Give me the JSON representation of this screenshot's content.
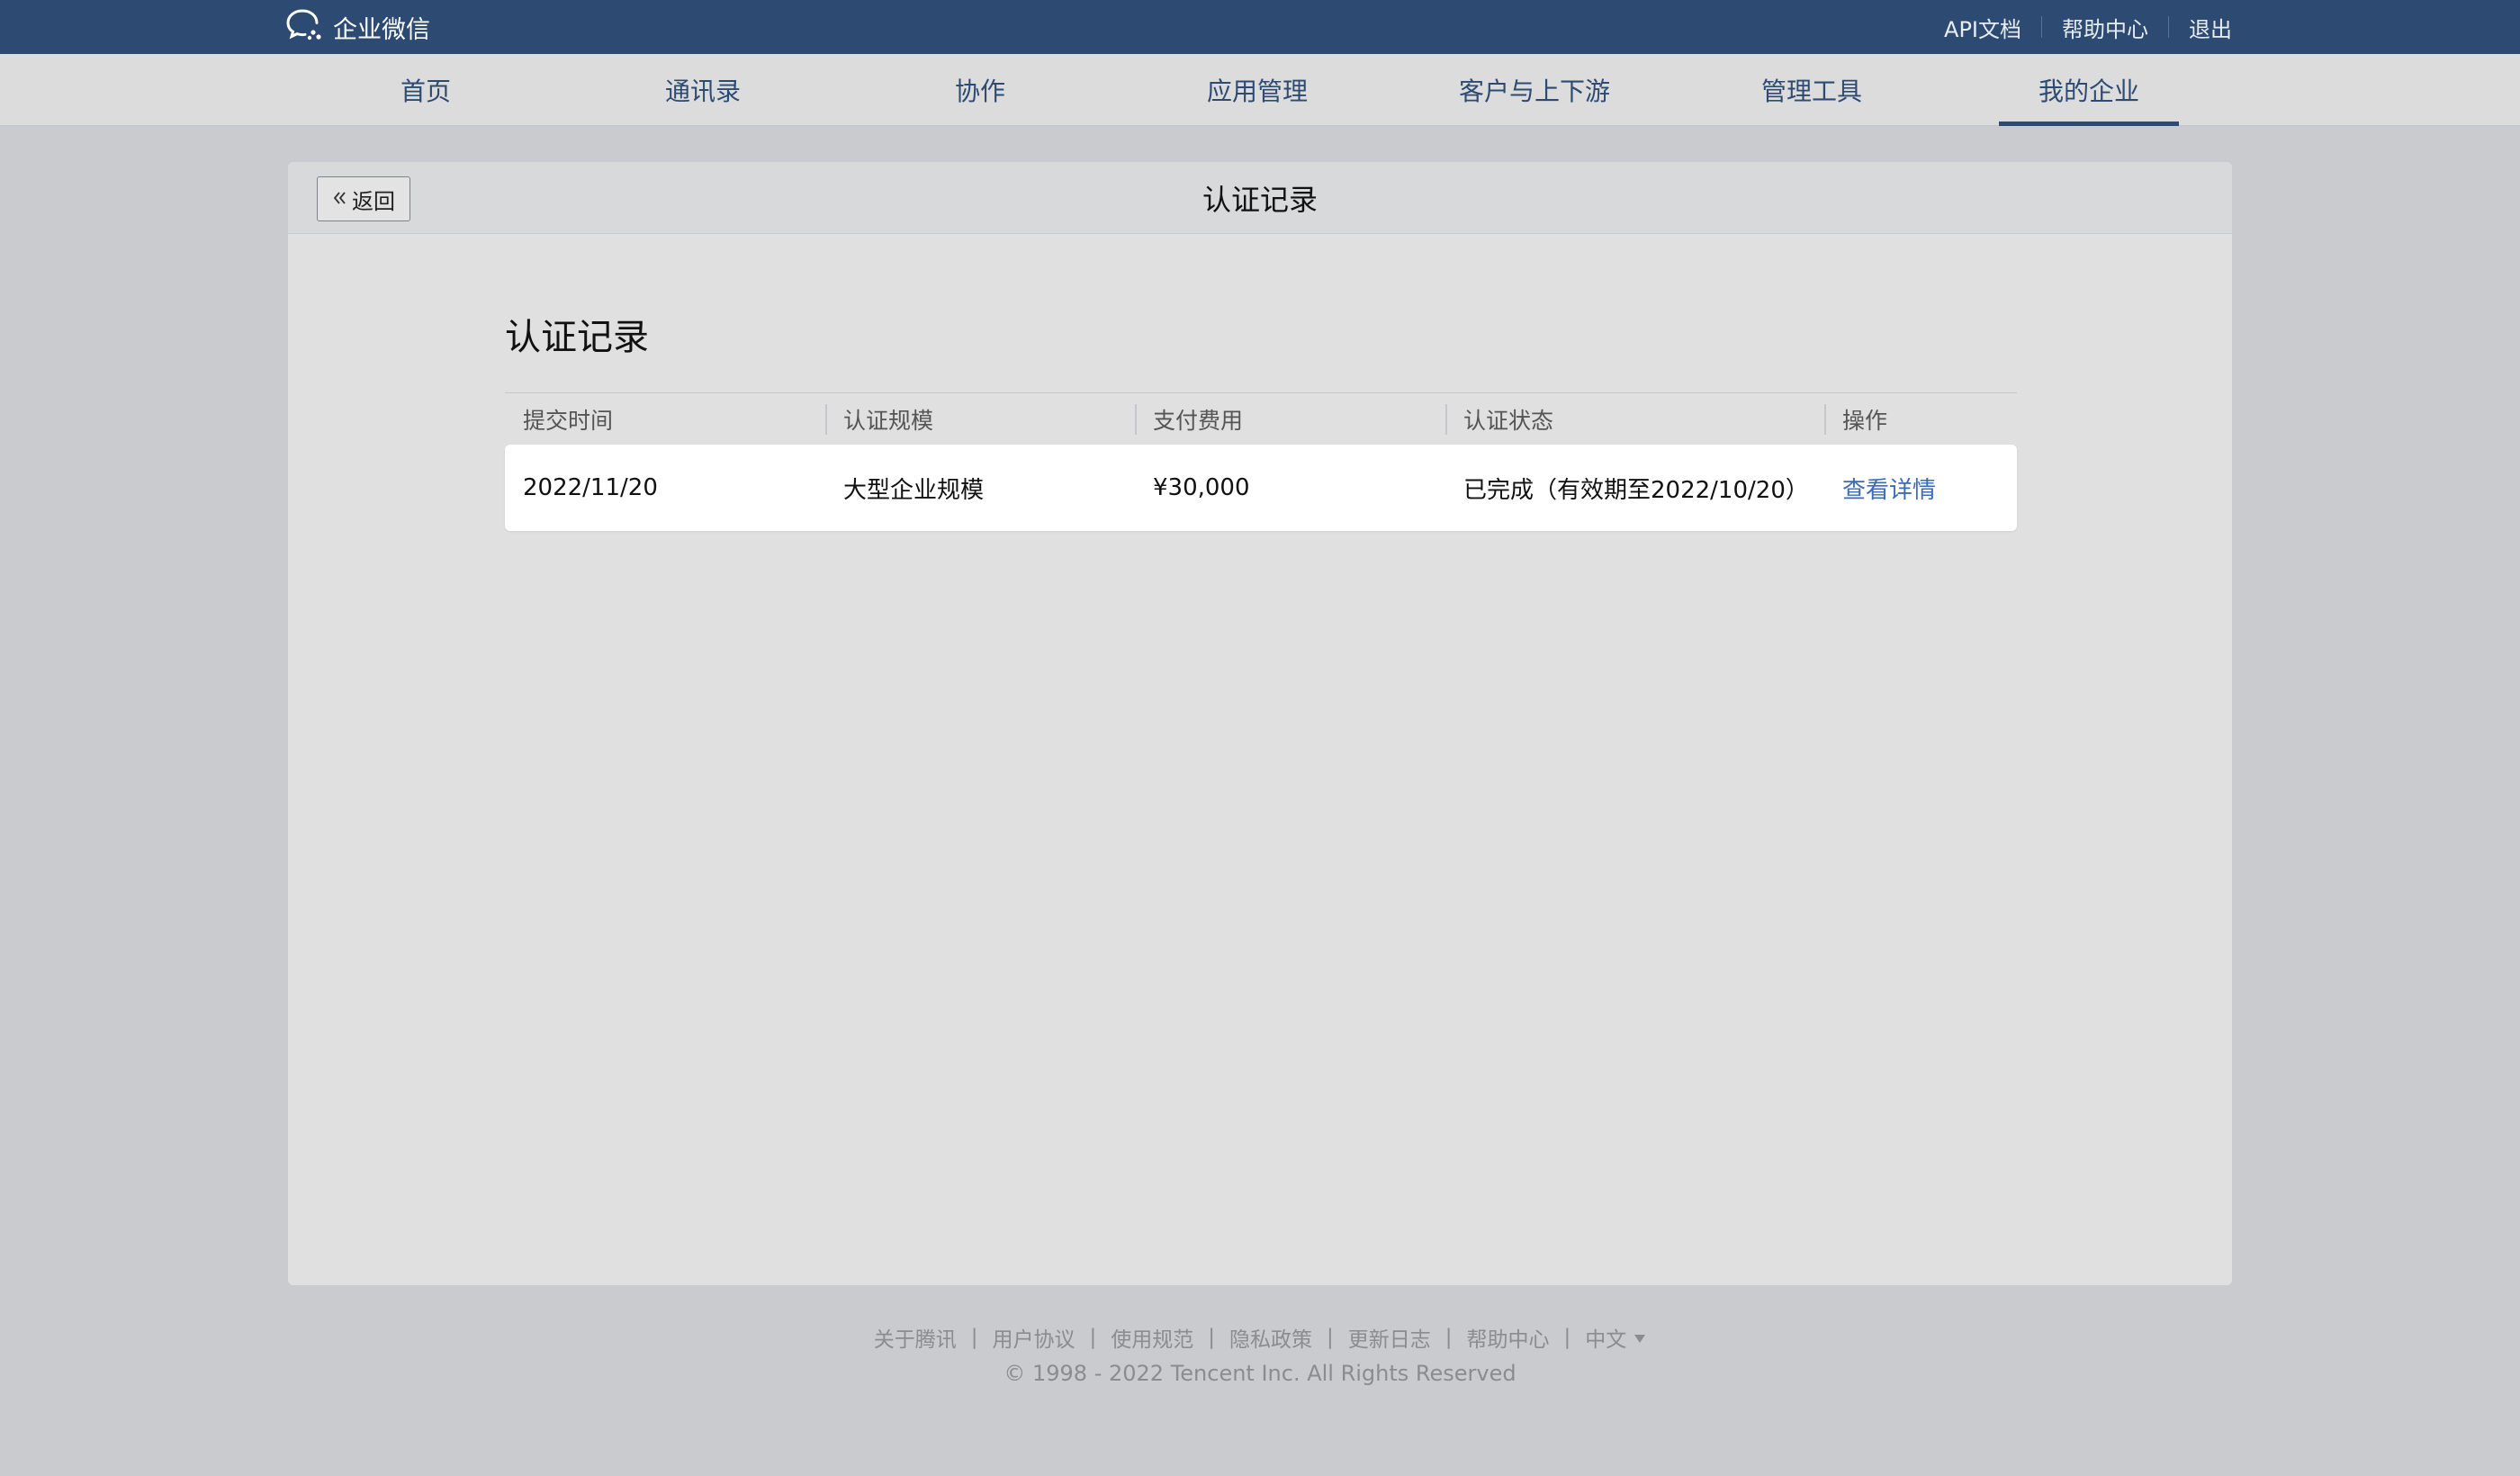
{
  "topbar": {
    "brand": "企业微信",
    "links": [
      "API文档",
      "帮助中心",
      "退出"
    ]
  },
  "nav": {
    "items": [
      "首页",
      "通讯录",
      "协作",
      "应用管理",
      "客户与上下游",
      "管理工具",
      "我的企业"
    ],
    "active": "我的企业"
  },
  "page": {
    "back_label": "返回",
    "header_title": "认证记录",
    "section_title": "认证记录"
  },
  "table": {
    "columns": [
      "提交时间",
      "认证规模",
      "支付费用",
      "认证状态",
      "操作"
    ],
    "rows": [
      {
        "submit_time": "2022/11/20",
        "scale": "大型企业规模",
        "fee": "¥30,000",
        "status": "已完成（有效期至2022/10/20）",
        "action": "查看详情"
      }
    ]
  },
  "footer": {
    "links": [
      "关于腾讯",
      "用户协议",
      "使用规范",
      "隐私政策",
      "更新日志",
      "帮助中心"
    ],
    "language": "中文",
    "copyright": "© 1998 - 2022 Tencent Inc. All Rights Reserved"
  },
  "colors": {
    "brand_bar": "#2d4b72",
    "link": "#3b6bb5"
  }
}
